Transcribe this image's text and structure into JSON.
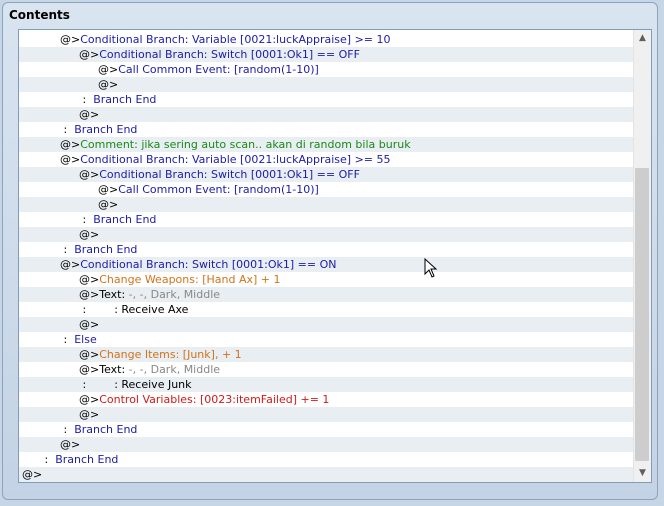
{
  "panel": {
    "title": "Contents"
  },
  "rows": [
    {
      "indent": 2,
      "prefix": "@>",
      "text": "Conditional Branch: Variable [0021:luckAppraise] >= 10",
      "color": "blue"
    },
    {
      "indent": 3,
      "prefix": "@>",
      "text": "Conditional Branch: Switch [0001:Ok1] == OFF",
      "color": "blue"
    },
    {
      "indent": 4,
      "prefix": "@>",
      "text": "Call Common Event: [random(1-10)]",
      "color": "blue"
    },
    {
      "indent": 4,
      "prefix": "@>",
      "text": "",
      "color": "black"
    },
    {
      "indent": 3,
      "prefix": " :  ",
      "text": "Branch End",
      "color": "blue"
    },
    {
      "indent": 3,
      "prefix": "@>",
      "text": "",
      "color": "black"
    },
    {
      "indent": 2,
      "prefix": " :  ",
      "text": "Branch End",
      "color": "blue"
    },
    {
      "indent": 2,
      "prefix": "@>",
      "text": "Comment: jika sering auto scan.. akan di random bila buruk",
      "color": "green"
    },
    {
      "indent": 2,
      "prefix": "@>",
      "text": "Conditional Branch: Variable [0021:luckAppraise] >= 55",
      "color": "blue"
    },
    {
      "indent": 3,
      "prefix": "@>",
      "text": "Conditional Branch: Switch [0001:Ok1] == OFF",
      "color": "blue"
    },
    {
      "indent": 4,
      "prefix": "@>",
      "text": "Call Common Event: [random(1-10)]",
      "color": "blue"
    },
    {
      "indent": 4,
      "prefix": "@>",
      "text": "",
      "color": "black"
    },
    {
      "indent": 3,
      "prefix": " :  ",
      "text": "Branch End",
      "color": "blue"
    },
    {
      "indent": 3,
      "prefix": "@>",
      "text": "",
      "color": "black"
    },
    {
      "indent": 2,
      "prefix": " :  ",
      "text": "Branch End",
      "color": "blue"
    },
    {
      "indent": 2,
      "prefix": "@>",
      "text": "Conditional Branch: Switch [0001:Ok1] == ON",
      "color": "blue"
    },
    {
      "indent": 3,
      "prefix": "@>",
      "text": "Change Weapons: [Hand Ax] + 1",
      "color": "orange"
    },
    {
      "indent": 3,
      "prefix": "@>",
      "text": "Text: ",
      "sub": "-, -, Dark, Middle",
      "color": "black"
    },
    {
      "indent": 3,
      "prefix": " :        ",
      "text": ": Receive Axe",
      "color": "black"
    },
    {
      "indent": 3,
      "prefix": "@>",
      "text": "",
      "color": "black"
    },
    {
      "indent": 2,
      "prefix": " :  ",
      "text": "Else",
      "color": "blue"
    },
    {
      "indent": 3,
      "prefix": "@>",
      "text": "Change Items: [Junk], + 1",
      "color": "orange"
    },
    {
      "indent": 3,
      "prefix": "@>",
      "text": "Text: ",
      "sub": "-, -, Dark, Middle",
      "color": "black"
    },
    {
      "indent": 3,
      "prefix": " :        ",
      "text": ": Receive Junk",
      "color": "black"
    },
    {
      "indent": 3,
      "prefix": "@>",
      "text": "Control Variables: [0023:itemFailed] += 1",
      "color": "red"
    },
    {
      "indent": 3,
      "prefix": "@>",
      "text": "",
      "color": "black"
    },
    {
      "indent": 2,
      "prefix": " :  ",
      "text": "Branch End",
      "color": "blue"
    },
    {
      "indent": 2,
      "prefix": "@>",
      "text": "",
      "color": "black"
    },
    {
      "indent": 1,
      "prefix": " :  ",
      "text": "Branch End",
      "color": "blue"
    },
    {
      "indent": 0,
      "prefix": "@>",
      "text": "",
      "color": "black"
    }
  ],
  "scrollbar": {
    "up_icon": "triangle-up-icon",
    "down_icon": "triangle-down-icon"
  },
  "cursor_icon": "mouse-pointer-icon"
}
